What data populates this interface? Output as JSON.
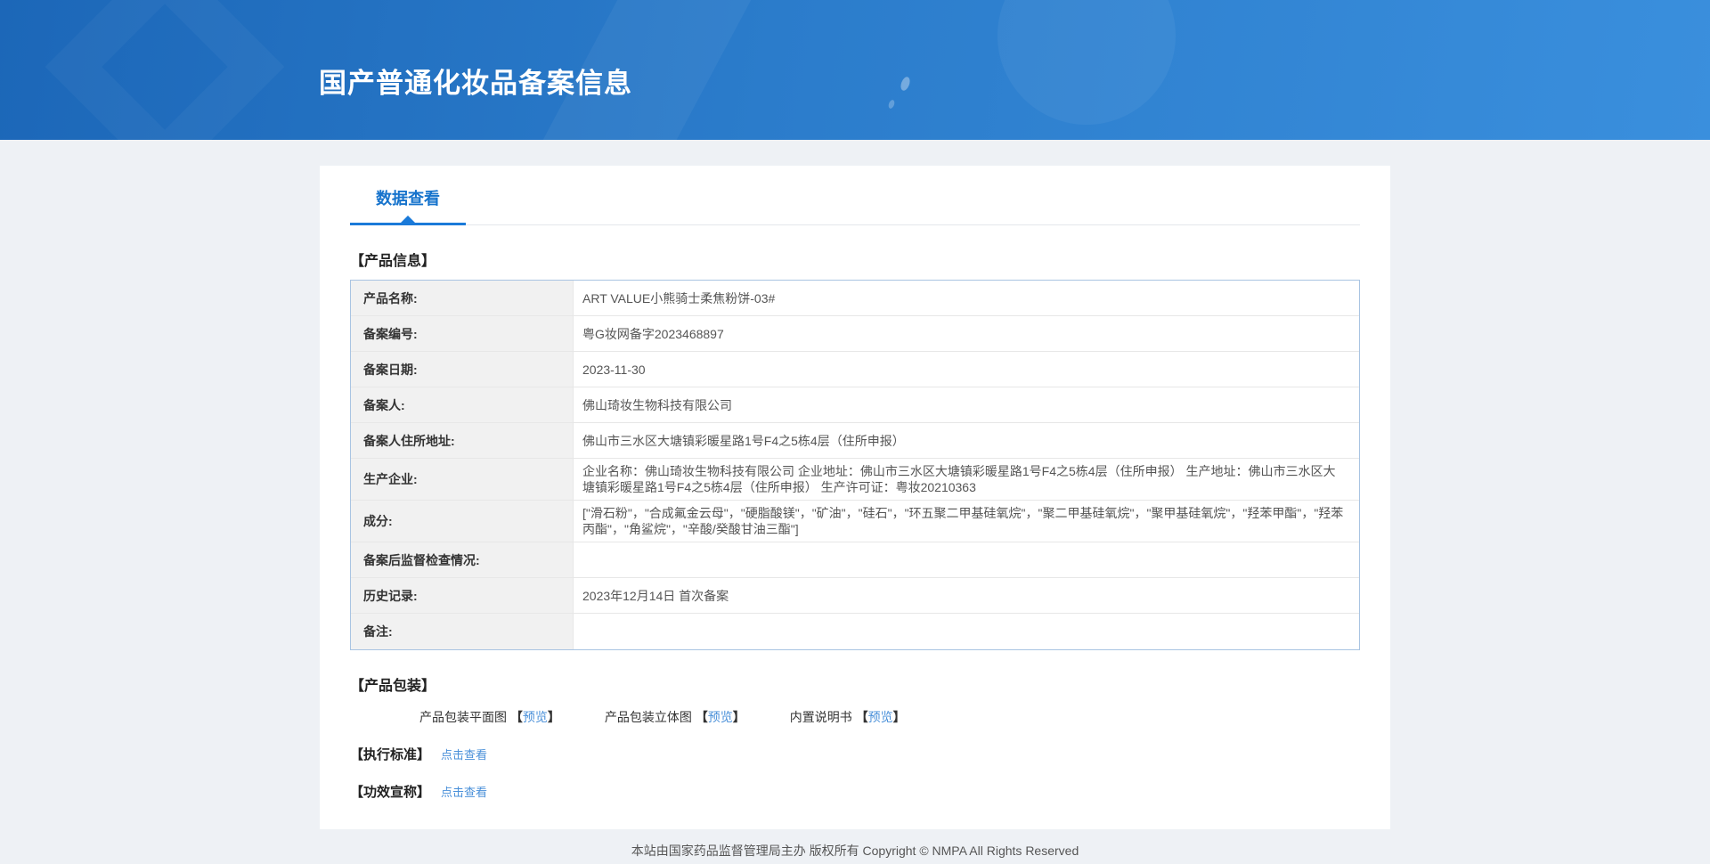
{
  "page": {
    "title": "国产普通化妆品备案信息"
  },
  "tabs": {
    "active": "数据查看"
  },
  "product_info": {
    "section_title": "【产品信息】",
    "rows": [
      {
        "label": "产品名称:",
        "value": "ART VALUE小熊骑士柔焦粉饼-03#"
      },
      {
        "label": "备案编号:",
        "value": "粤G妆网备字2023468897"
      },
      {
        "label": "备案日期:",
        "value": "2023-11-30"
      },
      {
        "label": "备案人:",
        "value": "佛山琦妆生物科技有限公司"
      },
      {
        "label": "备案人住所地址:",
        "value": "佛山市三水区大塘镇彩暖星路1号F4之5栋4层（住所申报）"
      },
      {
        "label": "生产企业:",
        "value": "企业名称：佛山琦妆生物科技有限公司 企业地址：佛山市三水区大塘镇彩暖星路1号F4之5栋4层（住所申报） 生产地址：佛山市三水区大塘镇彩暖星路1号F4之5栋4层（住所申报） 生产许可证：粤妆20210363"
      },
      {
        "label": "成分:",
        "value": "[\"滑石粉\"，\"合成氟金云母\"，\"硬脂酸镁\"，\"矿油\"，\"硅石\"，\"环五聚二甲基硅氧烷\"，\"聚二甲基硅氧烷\"，\"聚甲基硅氧烷\"，\"羟苯甲酯\"，\"羟苯丙酯\"，\"角鲨烷\"，\"辛酸/癸酸甘油三酯\"]"
      },
      {
        "label": "备案后监督检查情况:",
        "value": ""
      },
      {
        "label": "历史记录:",
        "value": "2023年12月14日 首次备案"
      },
      {
        "label": "备注:",
        "value": ""
      }
    ]
  },
  "packaging": {
    "section_title": "【产品包装】",
    "items": [
      {
        "label": "产品包装平面图",
        "bracket_open": "【",
        "link": "预览",
        "bracket_close": "】"
      },
      {
        "label": "产品包装立体图",
        "bracket_open": "【",
        "link": "预览",
        "bracket_close": "】"
      },
      {
        "label": "内置说明书",
        "bracket_open": "【",
        "link": "预览",
        "bracket_close": "】"
      }
    ]
  },
  "standards": {
    "label": "【执行标准】",
    "link": "点击查看"
  },
  "efficacy": {
    "label": "【功效宣称】",
    "link": "点击查看"
  },
  "footer": {
    "text": "本站由国家药品监督管理局主办 版权所有 Copyright © NMPA All Rights Reserved"
  },
  "colors": {
    "accent_blue": "#1a7ad9",
    "tab_text_blue": "#1673cc",
    "link_blue": "#4a90d9",
    "header_gradient_start": "#1c67b8",
    "header_gradient_end": "#3a8fdd",
    "table_border": "#a9c4e2",
    "label_cell_bg": "#f1f1f1"
  }
}
